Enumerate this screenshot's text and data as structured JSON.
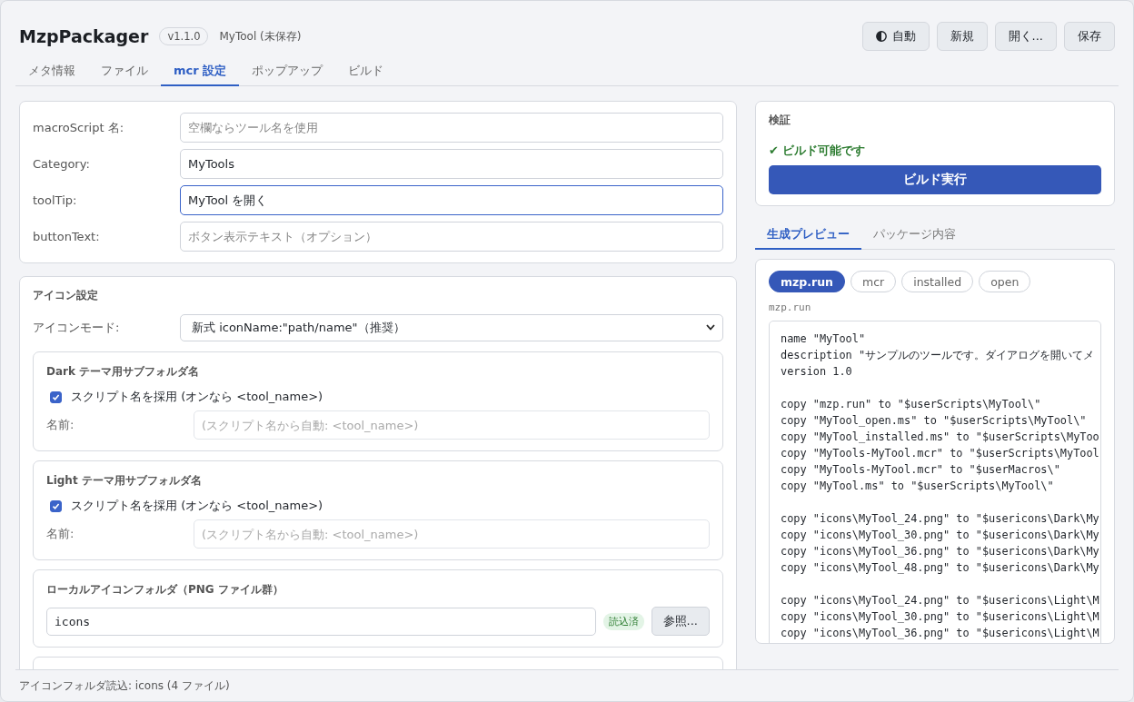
{
  "app": {
    "title": "MzpPackager",
    "version": "v1.1.0",
    "document": "MyTool (未保存)"
  },
  "header_buttons": [
    {
      "kind": "theme",
      "label": "自動"
    },
    {
      "kind": "plain",
      "label": "新規"
    },
    {
      "kind": "plain",
      "label": "開く..."
    },
    {
      "kind": "plain",
      "label": "保存"
    }
  ],
  "tabs": [
    {
      "label": "メタ情報",
      "selected": false
    },
    {
      "label": "ファイル",
      "selected": false
    },
    {
      "label": "mcr 設定",
      "selected": true
    },
    {
      "label": "ポップアップ",
      "selected": false
    },
    {
      "label": "ビルド",
      "selected": false
    }
  ],
  "mcr_form": [
    {
      "label": "macroScript 名:",
      "placeholder": "空欄ならツール名を使用",
      "focused": false
    },
    {
      "label": "Category:",
      "value": "MyTools",
      "focused": false
    },
    {
      "label": "toolTip:",
      "value": "MyTool を開く",
      "focused": true
    },
    {
      "label": "buttonText:",
      "placeholder": "ボタン表示テキスト（オプション）",
      "focused": false
    }
  ],
  "icon_settings": {
    "title": "アイコン設定",
    "mode_label": "アイコンモード:",
    "mode_value": "新式 iconName:\"path/name\"（推奨）",
    "theme_folders": [
      {
        "title": "Dark テーマ用サブフォルダ名",
        "checkbox_label": "スクリプト名を採用 (オンなら <tool_name>)",
        "checked": true,
        "name_label": "名前:",
        "name_placeholder": "(スクリプト名から自動: <tool_name>)"
      },
      {
        "title": "Light テーマ用サブフォルダ名",
        "checkbox_label": "スクリプト名を採用 (オンなら <tool_name>)",
        "checked": true,
        "name_label": "名前:",
        "name_placeholder": "(スクリプト名から自動: <tool_name>)"
      }
    ],
    "local_folder": {
      "title": "ローカルアイコンフォルダ（PNG ファイル群）",
      "value": "icons",
      "badge": "読込済",
      "button": "参照..."
    }
  },
  "validation": {
    "title": "検証",
    "message": "✔ ビルド可能です",
    "build_button": "ビルド実行"
  },
  "preview_tabs": [
    {
      "label": "生成プレビュー",
      "selected": true
    },
    {
      "label": "パッケージ内容",
      "selected": false
    }
  ],
  "file_chips": [
    {
      "label": "mzp.run",
      "selected": true
    },
    {
      "label": "mcr",
      "selected": false
    },
    {
      "label": "installed",
      "selected": false
    },
    {
      "label": "open",
      "selected": false
    }
  ],
  "file_name": "mzp.run",
  "code_blocks": [
    [
      "name \"MyTool\"",
      "description \"サンプルのツールです。ダイアログを開いてメ",
      "version 1.0"
    ],
    [
      "copy \"mzp.run\" to \"$userScripts\\MyTool\\\"",
      "copy \"MyTool_open.ms\" to \"$userScripts\\MyTool\\\"",
      "copy \"MyTool_installed.ms\" to \"$userScripts\\MyToo",
      "copy \"MyTools-MyTool.mcr\" to \"$userScripts\\MyTool",
      "copy \"MyTools-MyTool.mcr\" to \"$userMacros\\\"",
      "copy \"MyTool.ms\" to \"$userScripts\\MyTool\\\""
    ],
    [
      "copy \"icons\\MyTool_24.png\" to \"$usericons\\Dark\\My",
      "copy \"icons\\MyTool_30.png\" to \"$usericons\\Dark\\My",
      "copy \"icons\\MyTool_36.png\" to \"$usericons\\Dark\\My",
      "copy \"icons\\MyTool_48.png\" to \"$usericons\\Dark\\My"
    ],
    [
      "copy \"icons\\MyTool_24.png\" to \"$usericons\\Light\\M",
      "copy \"icons\\MyTool_30.png\" to \"$usericons\\Light\\M",
      "copy \"icons\\MyTool_36.png\" to \"$usericons\\Light\\M"
    ]
  ],
  "status_bar": "アイコンフォルダ読込: icons (4 ファイル)"
}
